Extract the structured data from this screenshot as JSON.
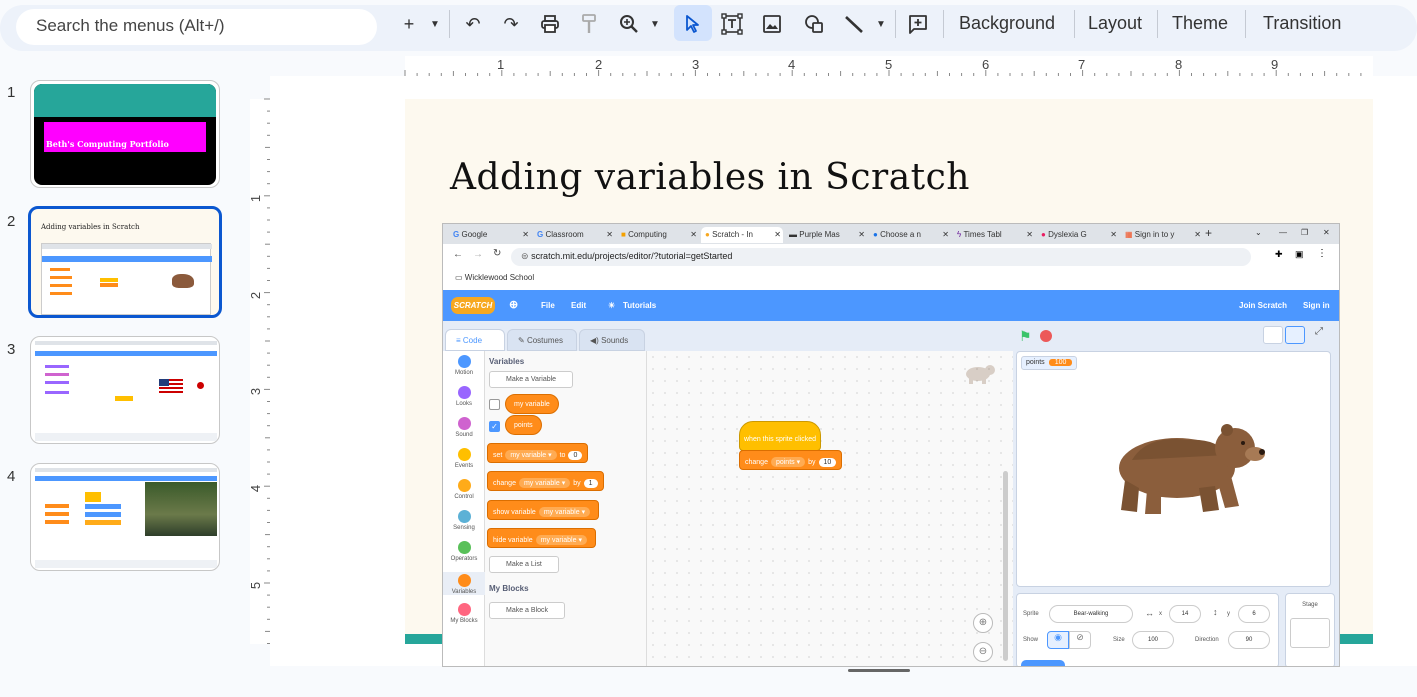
{
  "toolbar": {
    "search_placeholder": "Search the menus (Alt+/)",
    "add_icon": "+",
    "undo_icon": "↶",
    "redo_icon": "↷",
    "print_icon": "print",
    "paint_icon": "paint-format",
    "zoom_icon": "zoom",
    "select_icon": "cursor",
    "textbox_icon": "text-box",
    "image_icon": "image",
    "shape_icon": "shape",
    "line_icon": "line",
    "comment_icon": "comment",
    "background_label": "Background",
    "layout_label": "Layout",
    "theme_label": "Theme",
    "transition_label": "Transition"
  },
  "slides": [
    {
      "num": "1",
      "title": "Beth's Computing Portfolio"
    },
    {
      "num": "2",
      "title": "Adding variables in Scratch"
    },
    {
      "num": "3"
    },
    {
      "num": "4"
    }
  ],
  "ruler_top": [
    "1",
    "2",
    "3",
    "4",
    "5",
    "6",
    "7",
    "8",
    "9"
  ],
  "ruler_left": [
    "1",
    "2",
    "3",
    "4",
    "5"
  ],
  "slide": {
    "title": "Adding variables in Scratch"
  },
  "browser": {
    "tabs": [
      "Google",
      "Classroom",
      "Computing",
      "Scratch - In",
      "Purple Mas",
      "Choose a n",
      "Times Tabl",
      "Dyslexia G",
      "Sign in to y"
    ],
    "url": "scratch.mit.edu/projects/editor/?tutorial=getStarted",
    "bookmark": "Wicklewood School"
  },
  "scratch": {
    "logo": "SCRATCH",
    "menu": {
      "file": "File",
      "edit": "Edit",
      "tutorials": "Tutorials",
      "join": "Join Scratch",
      "signin": "Sign in"
    },
    "tabs": {
      "code": "Code",
      "costumes": "Costumes",
      "sounds": "Sounds"
    },
    "categories": [
      {
        "name": "Motion",
        "color": "#4c97ff"
      },
      {
        "name": "Looks",
        "color": "#9966ff"
      },
      {
        "name": "Sound",
        "color": "#cf63cf"
      },
      {
        "name": "Events",
        "color": "#ffbf00"
      },
      {
        "name": "Control",
        "color": "#ffab19"
      },
      {
        "name": "Sensing",
        "color": "#5cb1d6"
      },
      {
        "name": "Operators",
        "color": "#59c059"
      },
      {
        "name": "Variables",
        "color": "#ff8c1a"
      },
      {
        "name": "My Blocks",
        "color": "#ff6680"
      }
    ],
    "palette": {
      "variables_heading": "Variables",
      "make_variable": "Make a Variable",
      "var1": "my variable",
      "var2": "points",
      "set_label": "set",
      "set_var": "my variable",
      "set_to": "to",
      "set_val": "0",
      "change_label": "change",
      "change_var": "my variable",
      "change_by": "by",
      "change_val": "1",
      "show_label": "show variable",
      "show_var": "my variable",
      "hide_label": "hide variable",
      "hide_var": "my variable",
      "make_list": "Make a List",
      "myblocks_heading": "My Blocks",
      "make_block": "Make a Block"
    },
    "script": {
      "hat": "when this sprite clicked",
      "change_label": "change",
      "change_var": "points",
      "change_by": "by",
      "change_val": "10"
    },
    "monitor": {
      "name": "points",
      "value": "100"
    },
    "sprite": {
      "label": "Sprite",
      "name": "Bear-walking",
      "x_label": "x",
      "x": "14",
      "y_label": "y",
      "y": "6",
      "show_label": "Show",
      "size_label": "Size",
      "size": "100",
      "direction_label": "Direction",
      "direction": "90"
    },
    "stage_label": "Stage"
  }
}
